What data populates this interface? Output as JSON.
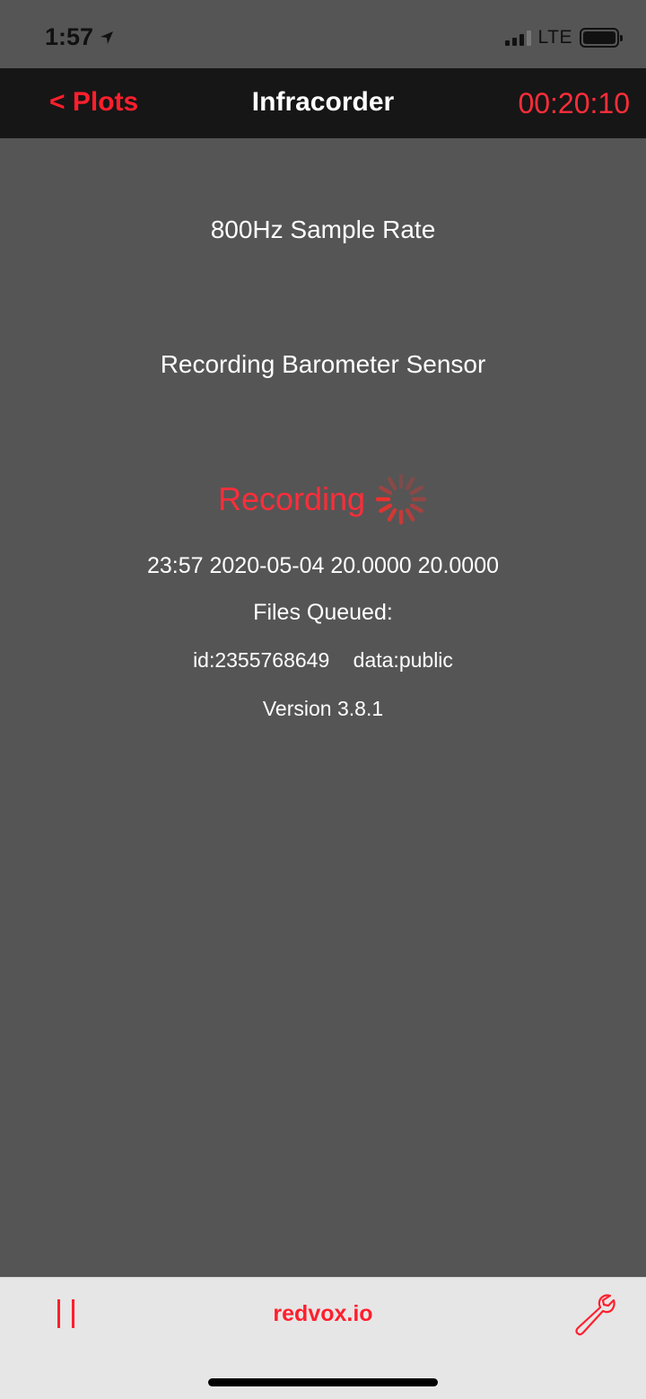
{
  "status_bar": {
    "time": "1:57",
    "network": "LTE",
    "icons": [
      "location-arrow-icon",
      "cellular-signal-icon",
      "battery-icon"
    ]
  },
  "nav": {
    "back_label": "< Plots",
    "title": "Infracorder",
    "timer": "00:20:10"
  },
  "main": {
    "sample_rate": "800Hz Sample Rate",
    "sensor": "Recording Barometer Sensor",
    "recording_label": "Recording",
    "info_line": "23:57 2020-05-04 20.0000 20.0000",
    "files_queued": "Files Queued:",
    "id": "id:2355768649",
    "data_access": "data:public",
    "version": "Version 3.8.1"
  },
  "tab_bar": {
    "brand": "redvox.io",
    "icons": [
      "pause-icon",
      "wrench-icon"
    ]
  },
  "colors": {
    "accent": "#ff1f2d",
    "background": "#555555",
    "nav_background": "#161616",
    "tab_background": "#e6e6e6"
  }
}
